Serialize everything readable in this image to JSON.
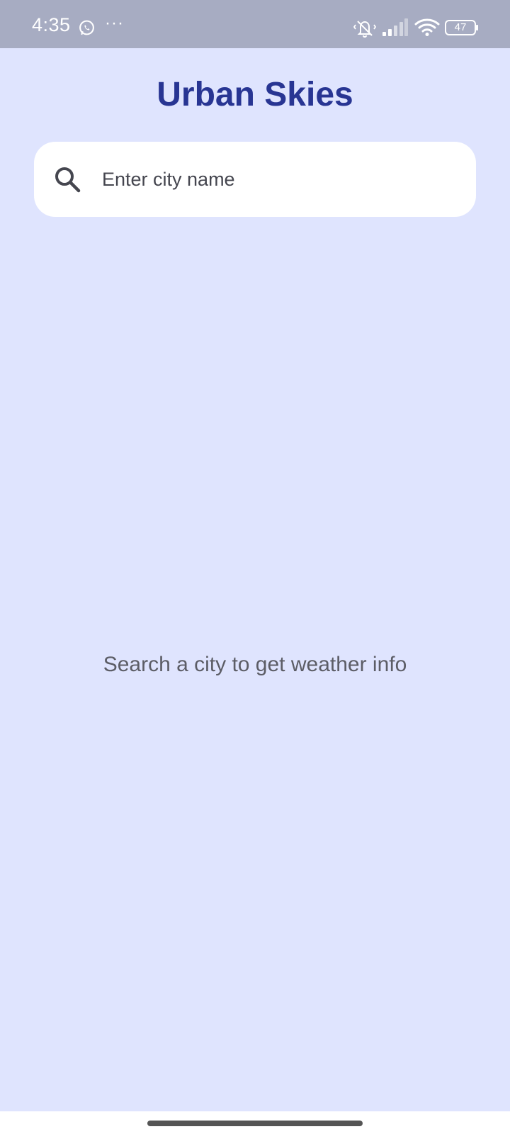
{
  "status_bar": {
    "time": "4:35",
    "dots": "···",
    "battery_level": "47",
    "icons": [
      "whatsapp-icon",
      "more-dots-icon",
      "vibrate-mute-icon",
      "cell-signal-icon",
      "wifi-icon",
      "battery-icon"
    ]
  },
  "app": {
    "title": "Urban Skies"
  },
  "search": {
    "placeholder": "Enter city name",
    "value": "",
    "icon": "search-icon"
  },
  "main": {
    "empty_message": "Search a city to get weather info"
  },
  "colors": {
    "background": "#dfe4fe",
    "title": "#283593",
    "status_bar": "#a7acc2",
    "search_bg": "#ffffff",
    "message_text": "#5c5d66"
  }
}
